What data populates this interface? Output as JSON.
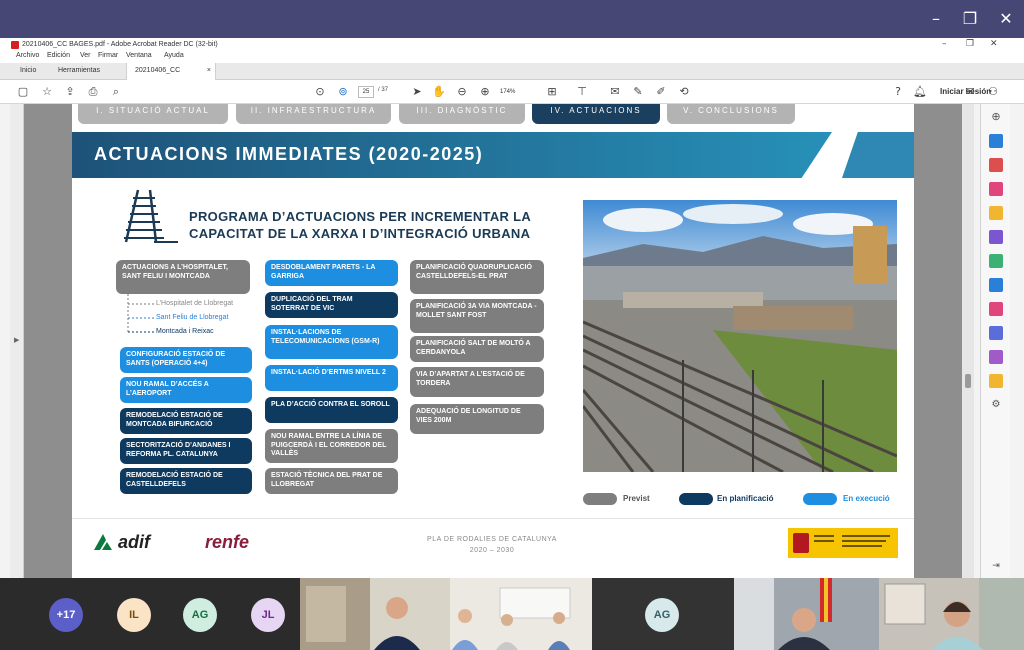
{
  "acrobat": {
    "window_title": "20210406_CC BAGES.pdf - Adobe Acrobat Reader DC (32-bit)",
    "menu": [
      "Archivo",
      "Edición",
      "Ver",
      "Firmar",
      "Ventana",
      "Ayuda"
    ],
    "tabs": [
      "Inicio",
      "Herramientas",
      "20210406_CC BAGE..."
    ],
    "page_current": "25",
    "page_total": "/ 37",
    "zoom": "174%",
    "signin": "Iniciar sesión"
  },
  "slide": {
    "sections": [
      "I. SITUACIÓ ACTUAL",
      "II. INFRAESTRUCTURA",
      "III. DIAGNÒSTIC",
      "IV. ACTUACIONS",
      "V. CONCLUSIONS"
    ],
    "title": "ACTUACIONS IMMEDIATES (2020-2025)",
    "program_title": "PROGRAMA D’ACTUACIONS PER INCREMENTAR LA CAPACITAT DE LA XARXA I D’INTEGRACIÓ URBANA",
    "col1": {
      "first": "ACTUACIONS A L’HOSPITALET, SANT FELIU I MONTCADA",
      "subs": [
        "L’Hospitalet de Llobregat",
        "Sant Feliu de Llobregat",
        "Montcada i Reixac"
      ],
      "items": [
        "CONFIGURACIÓ ESTACIÓ DE SANTS (OPERACIÓ 4+4)",
        "NOU RAMAL D’ACCÉS A L’AEROPORT",
        "REMODELACIÓ ESTACIÓ DE MONTCADA BIFURCACIÓ",
        "SECTORITZACIÓ D’ANDANES I REFORMA PL. CATALUNYA",
        "REMODELACIÓ ESTACIÓ DE CASTELLDEFELS"
      ]
    },
    "col2": [
      "DESDOBLAMENT PARETS - LA GARRIGA",
      "DUPLICACIÓ DEL TRAM SOTERRAT DE VIC",
      "INSTAL·LACIONS DE TELECOMUNICACIONS (GSM-R)",
      "INSTAL·LACIÓ D’ERTMS NIVELL 2",
      "PLA D’ACCIÓ CONTRA EL SOROLL",
      "NOU RAMAL ENTRE LA LÍNIA DE PUIGCERDÀ I EL CORREDOR DEL VALLÈS",
      "ESTACIÓ TÈCNICA DEL PRAT DE LLOBREGAT"
    ],
    "col3": [
      "PLANIFICACIÓ QUADRUPLICACIÓ CASTELLDEFELS-EL PRAT",
      "PLANIFICACIÓ 3A VIA MONTCADA - MOLLET SANT FOST",
      "PLANIFICACIÓ SALT DE MOLTÓ A CERDANYOLA",
      "VIA D’APARTAT A L’ESTACIÓ DE TORDERA",
      "ADEQUACIÓ DE LONGITUD DE VIES 200M"
    ],
    "legend": [
      "Previst",
      "En planificació",
      "En execució"
    ],
    "footer_center_1": "PLA DE RODALIES DE CATALUNYA",
    "footer_center_2": "2020 – 2030",
    "logo_adif": "adif",
    "logo_renfe": "renfe"
  },
  "participants": {
    "more": "+17",
    "initials": [
      "IL",
      "AG",
      "JL",
      "AG"
    ]
  },
  "colors": {
    "grey": "#7e7e7e",
    "dark": "#0f3a60",
    "light": "#1e8fe0",
    "teams_purple": "#464775"
  }
}
